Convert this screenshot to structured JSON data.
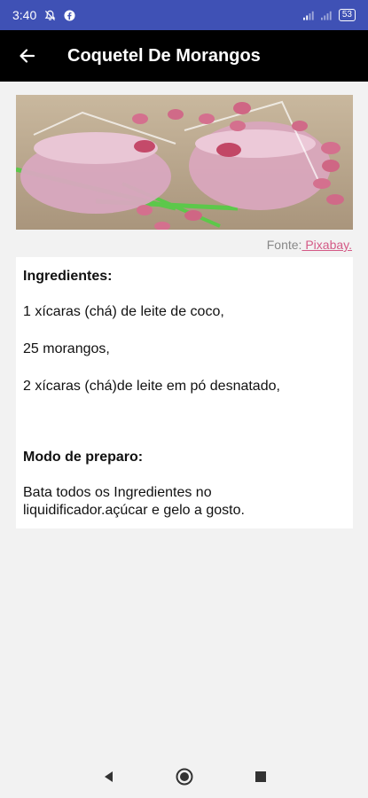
{
  "status_bar": {
    "time": "3:40",
    "battery": "53"
  },
  "app_bar": {
    "title": "Coquetel De Morangos"
  },
  "credit": {
    "prefix": "Fonte:",
    "link": " Pixabay."
  },
  "recipe": {
    "ingredients_heading": "Ingredientes:",
    "ingredients": [
      "1 xícaras (chá) de leite de coco,",
      "25 morangos,",
      "2 xícaras (chá)de leite em pó desnatado,"
    ],
    "method_heading": "Modo de preparo:",
    "method": "Bata todos os Ingredientes no liquidificador.açúcar e gelo a gosto."
  },
  "colors": {
    "status_bar": "#3f51b5",
    "app_bar": "#000000",
    "link": "#d45a86"
  }
}
